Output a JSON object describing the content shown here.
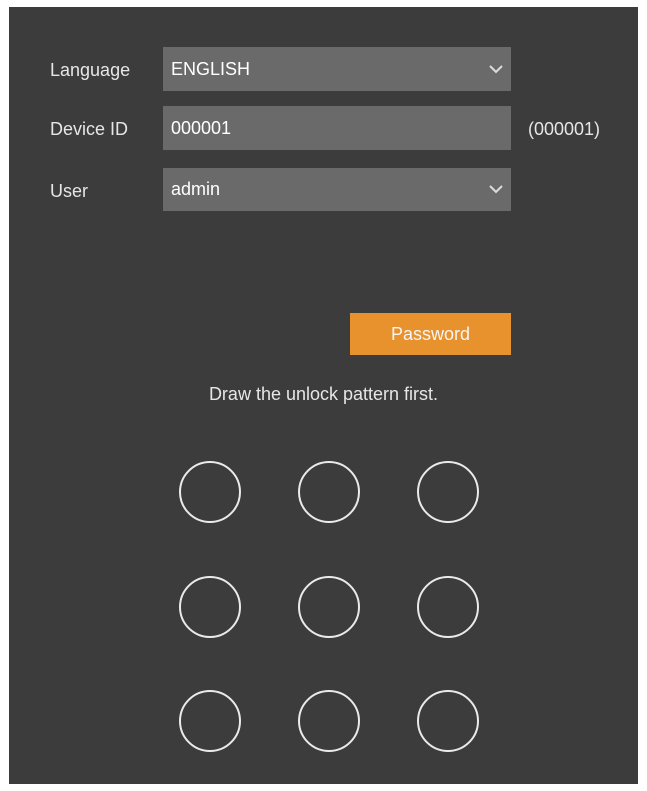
{
  "form": {
    "language": {
      "label": "Language",
      "value": "ENGLISH"
    },
    "device_id": {
      "label": "Device ID",
      "value": "000001",
      "hint": "(000001)"
    },
    "user": {
      "label": "User",
      "value": "admin"
    }
  },
  "password_button": "Password",
  "pattern": {
    "instruction": "Draw the unlock pattern first.",
    "grid_size": 3
  },
  "colors": {
    "panel_bg": "#3c3c3c",
    "field_bg": "#6a6a6a",
    "accent": "#e8922e",
    "text": "#e6e6e6"
  },
  "icons": {
    "dropdown": "chevron-down-icon",
    "pattern_node": "circle"
  }
}
